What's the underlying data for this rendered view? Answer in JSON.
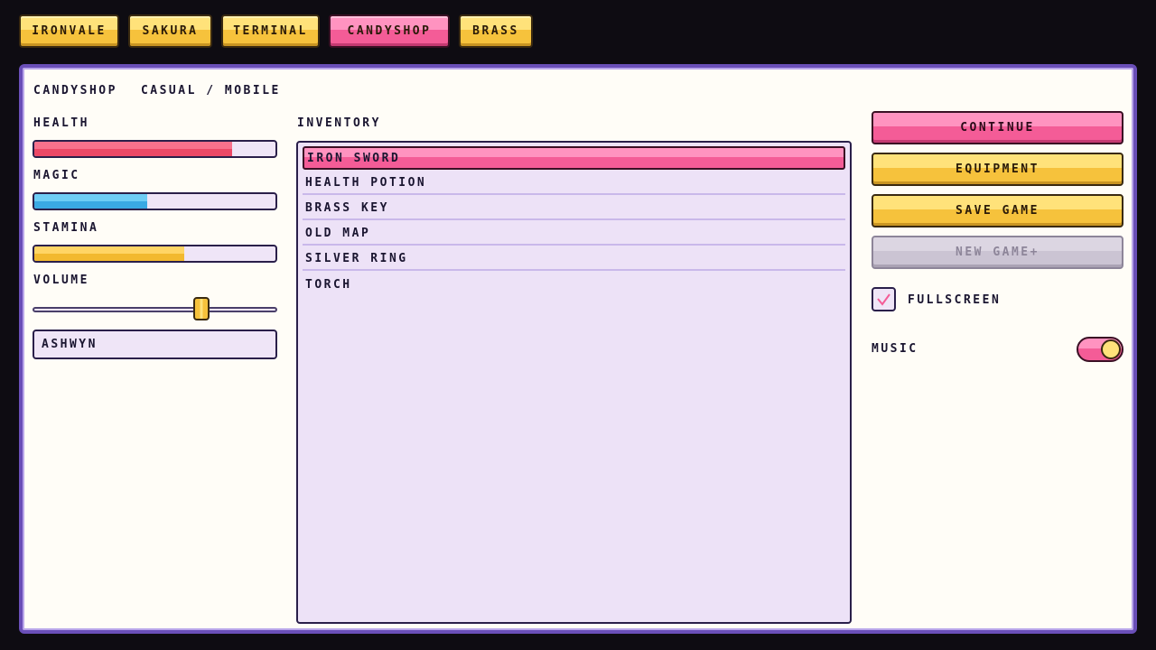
{
  "tabs": [
    {
      "label": "IRONVALE",
      "active": false
    },
    {
      "label": "SAKURA",
      "active": false
    },
    {
      "label": "TERMINAL",
      "active": false
    },
    {
      "label": "CANDYSHOP",
      "active": true
    },
    {
      "label": "BRASS",
      "active": false
    }
  ],
  "header": {
    "theme_name": "CANDYSHOP",
    "theme_style": "CASUAL / MOBILE"
  },
  "stats": {
    "health": {
      "label": "HEALTH",
      "fraction": 0.82,
      "color": "#ec4866"
    },
    "magic": {
      "label": "MAGIC",
      "fraction": 0.47,
      "color": "#3aa9e4"
    },
    "stamina": {
      "label": "STAMINA",
      "fraction": 0.62,
      "color": "#f2b92f"
    }
  },
  "volume": {
    "label": "VOLUME",
    "fraction": 0.69
  },
  "name_input": {
    "value": "ASHWYN"
  },
  "inventory": {
    "label": "INVENTORY",
    "items": [
      {
        "label": "IRON SWORD",
        "selected": true
      },
      {
        "label": "HEALTH POTION",
        "selected": false
      },
      {
        "label": "BRASS KEY",
        "selected": false
      },
      {
        "label": "OLD MAP",
        "selected": false
      },
      {
        "label": "SILVER RING",
        "selected": false
      },
      {
        "label": "TORCH",
        "selected": false
      }
    ]
  },
  "menu": {
    "continue_label": "CONTINUE",
    "equipment_label": "EQUIPMENT",
    "save_label": "SAVE GAME",
    "new_game_plus_label": "NEW GAME+"
  },
  "options": {
    "fullscreen_label": "FULLSCREEN",
    "fullscreen_checked": true,
    "music_label": "MUSIC",
    "music_on": true
  },
  "colors": {
    "accent_pink": "#f45c97",
    "accent_yellow": "#f6c23c",
    "panel_border": "#6a4fb8"
  }
}
